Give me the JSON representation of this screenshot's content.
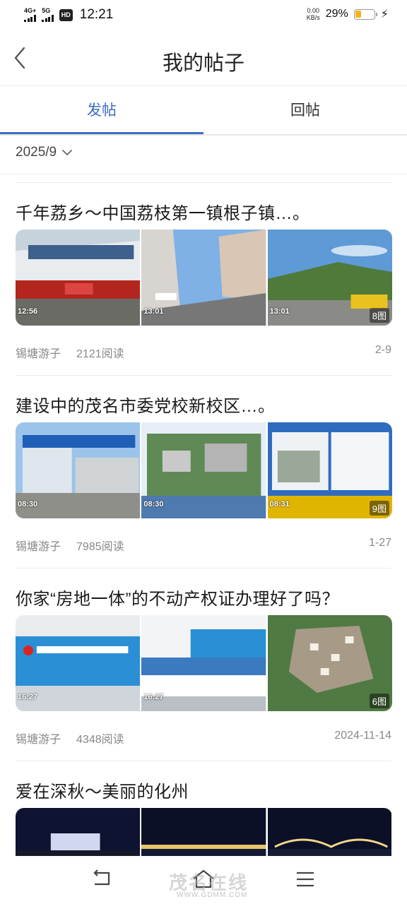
{
  "status_bar": {
    "signal1_label": "4G+",
    "signal2_label": "5G",
    "hd_label": "HD",
    "time": "12:21",
    "net_speed_value": "0.00",
    "net_speed_unit": "KB/s",
    "battery_percent": "29%",
    "battery_level": 0.29,
    "charging": true
  },
  "header": {
    "title": "我的帖子"
  },
  "tabs": [
    {
      "label": "发帖",
      "active": true
    },
    {
      "label": "回帖",
      "active": false
    }
  ],
  "filter": {
    "month": "2025/9"
  },
  "posts": [
    {
      "title": "千年荔乡～中国荔枝第一镇根子镇…。",
      "author": "锡塘游子",
      "reads": "2121阅读",
      "date": "2-9",
      "photo_count": "8图",
      "stamps": [
        "12:56",
        "13:01",
        "13:01"
      ]
    },
    {
      "title": "建设中的茂名市委党校新校区…。",
      "author": "锡塘游子",
      "reads": "7985阅读",
      "date": "1-27",
      "photo_count": "9图",
      "stamps": [
        "08:30",
        "08:30",
        "08:31"
      ]
    },
    {
      "title": "你家“房地一体”的不动产权证办理好了吗？",
      "author": "锡塘游子",
      "reads": "4348阅读",
      "date": "2024-11-14",
      "photo_count": "6图",
      "stamps": [
        "16:27",
        "16:27",
        ""
      ]
    },
    {
      "title": "爱在深秋～美丽的化州"
    }
  ],
  "watermark": {
    "text": "茂名在线",
    "url": "WWW.GDMM.COM"
  }
}
